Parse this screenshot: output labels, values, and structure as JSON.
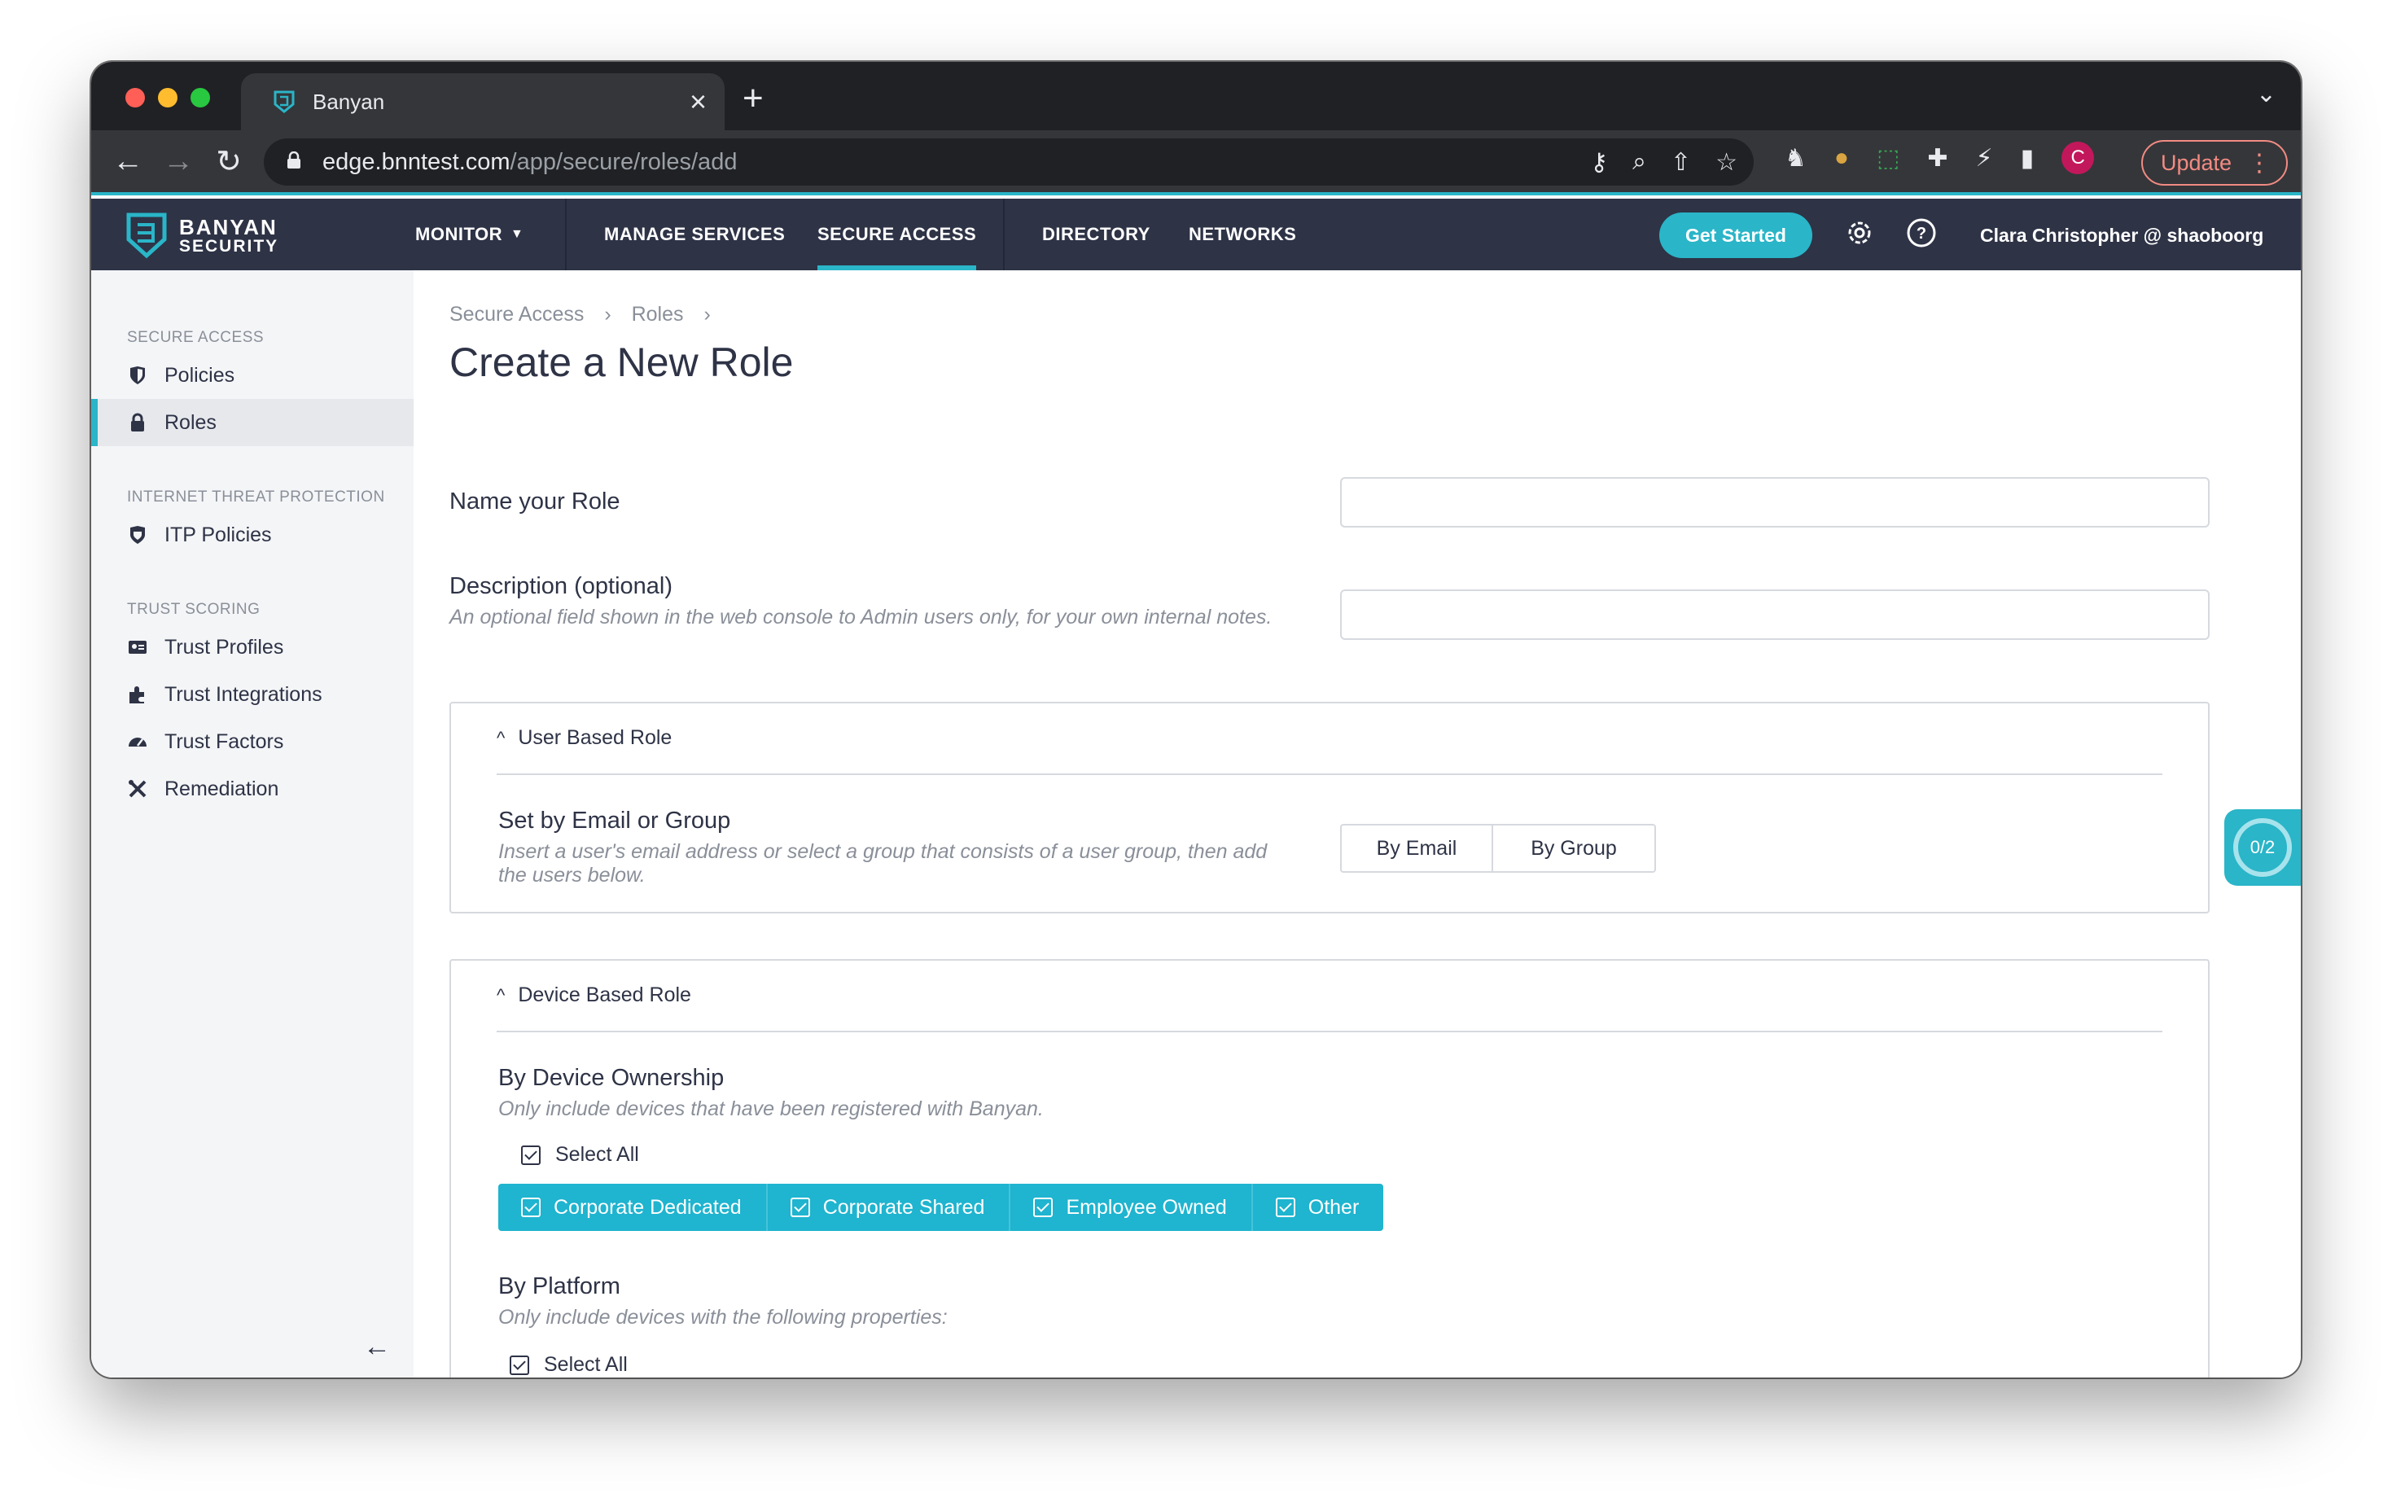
{
  "browser": {
    "tab_title": "Banyan",
    "url_host": "edge.bnntest.com",
    "url_path": "/app/secure/roles/add",
    "update_label": "Update",
    "profile_initial": "C"
  },
  "appnav": {
    "brand_line1": "BANYAN",
    "brand_line2": "SECURITY",
    "items": [
      "MONITOR",
      "MANAGE SERVICES",
      "SECURE ACCESS",
      "DIRECTORY",
      "NETWORKS"
    ],
    "active_item": "SECURE ACCESS",
    "get_started": "Get Started",
    "user": "Clara Christopher @ shaoboorg",
    "accent_color": "#2ab5c8"
  },
  "sidebar": {
    "sections": [
      {
        "title": "SECURE ACCESS",
        "items": [
          {
            "label": "Policies",
            "icon": "shield-icon"
          },
          {
            "label": "Roles",
            "icon": "lock-icon",
            "active": true
          }
        ]
      },
      {
        "title": "INTERNET THREAT PROTECTION",
        "items": [
          {
            "label": "ITP Policies",
            "icon": "shield-icon"
          }
        ]
      },
      {
        "title": "TRUST SCORING",
        "items": [
          {
            "label": "Trust Profiles",
            "icon": "id-card-icon"
          },
          {
            "label": "Trust Integrations",
            "icon": "puzzle-icon"
          },
          {
            "label": "Trust Factors",
            "icon": "gauge-icon"
          },
          {
            "label": "Remediation",
            "icon": "tools-icon"
          }
        ]
      }
    ]
  },
  "main": {
    "breadcrumbs": [
      "Secure Access",
      "Roles"
    ],
    "title": "Create a New Role",
    "name_label": "Name your Role",
    "name_value": "",
    "desc_label": "Description (optional)",
    "desc_help": "An optional field shown in the web console to Admin users only, for your own internal notes.",
    "desc_value": "",
    "user_panel": {
      "title": "User Based Role",
      "label": "Set by Email or Group",
      "help": "Insert a user's email address or select a group that consists of a user group, then add the users below.",
      "options": [
        "By Email",
        "By Group"
      ]
    },
    "device_panel": {
      "title": "Device Based Role",
      "ownership_label": "By Device Ownership",
      "ownership_help": "Only include devices that have been registered with Banyan.",
      "select_all": "Select All",
      "ownership_options": [
        "Corporate Dedicated",
        "Corporate Shared",
        "Employee Owned",
        "Other"
      ],
      "platform_label": "By Platform",
      "platform_help": "Only include devices with the following properties:",
      "platforms": [
        "apple-icon",
        "windows-icon",
        "linux-icon",
        "apple-icon",
        "android-icon"
      ]
    },
    "counter": "0/2"
  }
}
